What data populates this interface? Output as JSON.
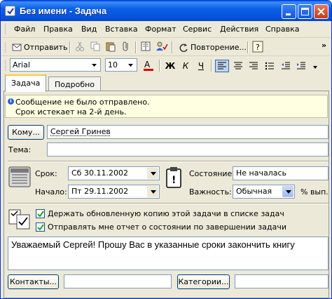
{
  "window": {
    "title": "Без имени - Задача",
    "controls": [
      "minimize-icon",
      "maximize-icon",
      "close-icon"
    ]
  },
  "menu": {
    "items": [
      "Файл",
      "Правка",
      "Вид",
      "Вставка",
      "Формат",
      "Сервис",
      "Действия",
      "Справка"
    ],
    "underline": [
      "Ф",
      "П",
      "В",
      "а",
      "о",
      "С",
      "Д",
      "п"
    ]
  },
  "toolbar": {
    "send_label": "Отправить",
    "recurrence_label": "Повторение...",
    "overflow": "»"
  },
  "format_bar": {
    "font": "Arial",
    "size": "10",
    "bold": "Ж",
    "italic": "К",
    "underline": "Ч"
  },
  "tabs": [
    "Задача",
    "Подробно"
  ],
  "active_tab": "Задача",
  "info": {
    "line1": "Сообщение не было отправлено.",
    "line2": "Срок истекает на 2-й день."
  },
  "form": {
    "to_button": "Кому...",
    "to_value": "Сергей Гринев",
    "subject_label": "Тема:",
    "subject_value": "",
    "due_label": "Срок:",
    "due_value": "Сб 30.11.2002",
    "start_label": "Начало:",
    "start_value": "Пт 29.11.2002",
    "status_label": "Состояние:",
    "status_value": "Не началась",
    "priority_label": "Важность:",
    "priority_value": "Обычная",
    "percent_label": "% вып.",
    "keep_copy_label": "Держать обновленную копию этой задачи в списке задач",
    "keep_copy_checked": true,
    "send_report_label": "Отправлять мне отчет о состоянии по завершении задачи",
    "send_report_checked": true,
    "body": "Уважаемый Сергей! Прошу Вас в указанные сроки закончить книгу",
    "contacts_button": "Контакты...",
    "contacts_value": "",
    "categories_button": "Категории...",
    "categories_value": ""
  },
  "colors": {
    "titlebar": "#0551d8",
    "info_background": "#ffffe1",
    "face": "#ece9d8",
    "active_tab_accent": "#ffc83c"
  }
}
